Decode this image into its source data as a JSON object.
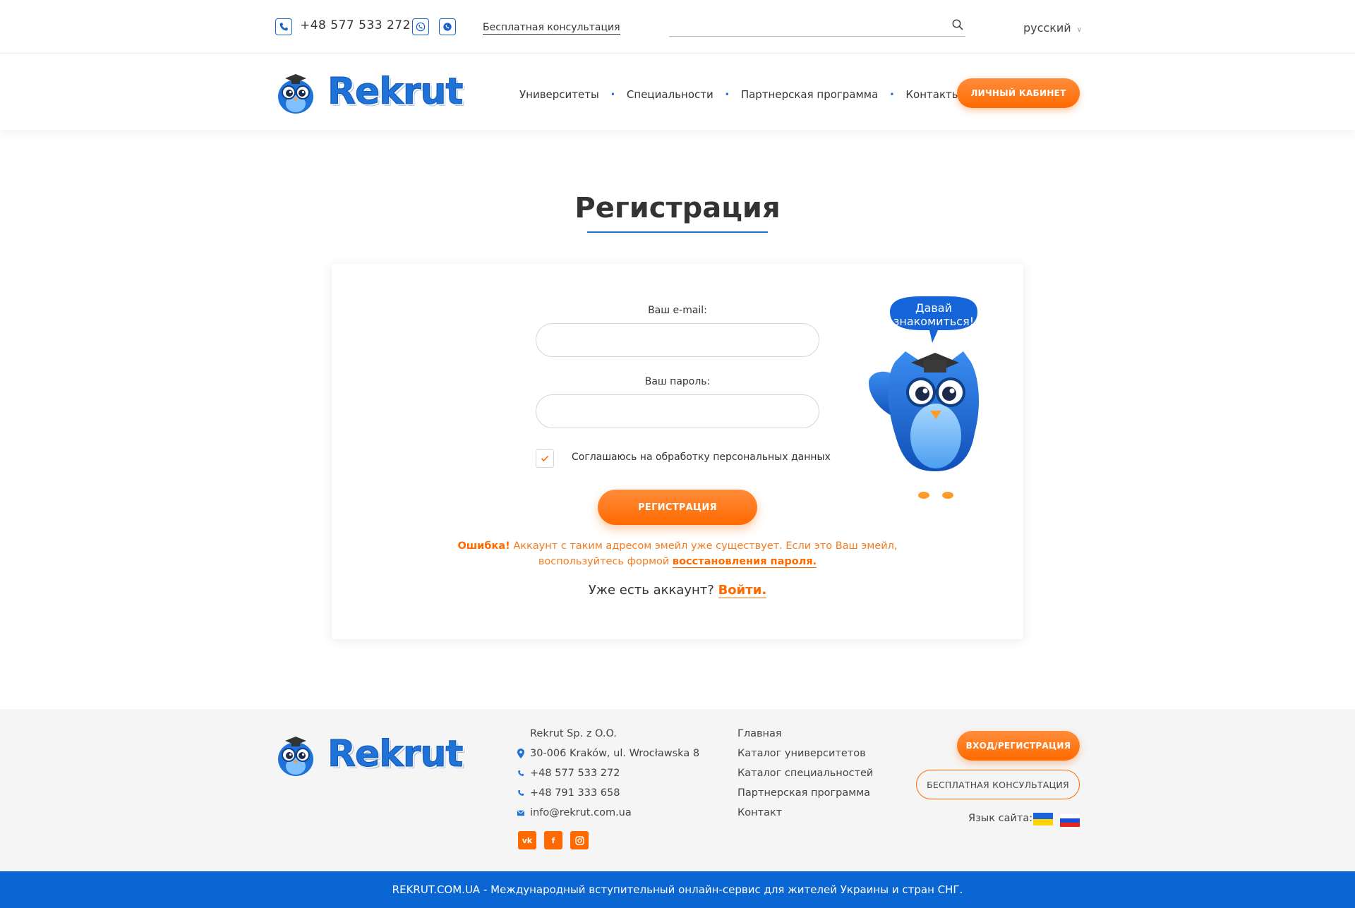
{
  "topbar": {
    "phone": "+48 577 533 272",
    "consult_link": "Бесплатная консультация",
    "search_placeholder": "",
    "language": "русский"
  },
  "header": {
    "logo_text": "Rekrut",
    "nav": [
      "Университеты",
      "Специальности",
      "Партнерская программа",
      "Контакты"
    ],
    "cabinet_button": "ЛИЧНЫЙ КАБИНЕТ"
  },
  "main": {
    "title": "Регистрация",
    "email_label": "Ваш e-mail:",
    "email_value": "",
    "password_label": "Ваш пароль:",
    "password_value": "",
    "consent_label": "Соглашаюсь на обработку персональных данных",
    "consent_checked": true,
    "register_button": "РЕГИСТРАЦИЯ",
    "error_prefix": "Ошибка!",
    "error_text_1": "Аккаунт с таким адресом эмейл уже существует. Если это Ваш эмейл,",
    "error_text_2": "воспользуйтесь формой",
    "error_link": "восстановления пароля.",
    "have_account": "Уже есть аккаунт?",
    "login_link": "Войти.",
    "mascot_bubble_line1": "Давай",
    "mascot_bubble_line2": "знакомиться!"
  },
  "footer": {
    "logo_text": "Rekrut",
    "company": "Rekrut Sp. z O.O.",
    "address": "30-006 Kraków, ul. Wrocławska 8",
    "phone1": "+48 577 533 272",
    "phone2": "+48 791 333 658",
    "email": "info@rekrut.com.ua",
    "links": [
      "Главная",
      "Каталог университетов",
      "Каталог специальностей",
      "Партнерская программа",
      "Контакт"
    ],
    "login_button": "ВХОД/РЕГИСТРАЦИЯ",
    "consult_button": "БЕСПЛАТНАЯ КОНСУЛЬТАЦИЯ",
    "site_language_label": "Язык сайта:",
    "social": [
      "vk-icon",
      "facebook-icon",
      "instagram-icon"
    ],
    "bottom_text": "REKRUT.COM.UA - Международный вступительный онлайн-сервис для жителей Украины и стран СНГ."
  },
  "colors": {
    "brand_blue": "#1e72d8",
    "accent_orange": "#ff6a00",
    "footer_bar": "#0a66d2"
  }
}
